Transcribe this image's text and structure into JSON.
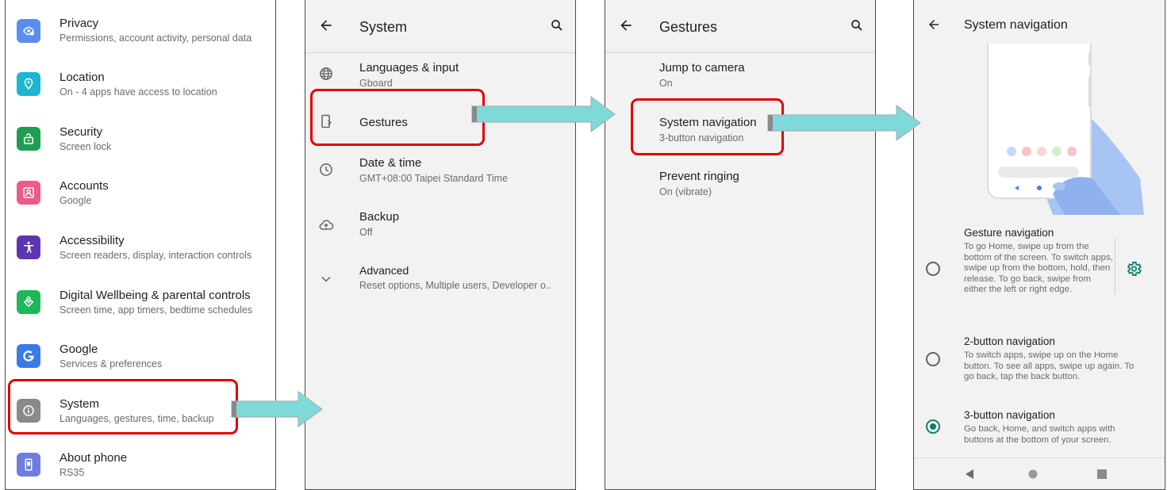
{
  "settings": {
    "items": [
      {
        "title": "Privacy",
        "subtitle": "Permissions, account activity, personal data",
        "icon": "privacy-icon",
        "color": "#5b8def"
      },
      {
        "title": "Location",
        "subtitle": "On - 4 apps have access to location",
        "icon": "location-icon",
        "color": "#1cb5d2"
      },
      {
        "title": "Security",
        "subtitle": "Screen lock",
        "icon": "lock-icon",
        "color": "#1e9e53"
      },
      {
        "title": "Accounts",
        "subtitle": "Google",
        "icon": "accounts-icon",
        "color": "#ec5b8d"
      },
      {
        "title": "Accessibility",
        "subtitle": "Screen readers, display, interaction controls",
        "icon": "accessibility-icon",
        "color": "#5e35b1"
      },
      {
        "title": "Digital Wellbeing & parental controls",
        "subtitle": "Screen time, app timers, bedtime schedules",
        "icon": "wellbeing-icon",
        "color": "#1cb85a"
      },
      {
        "title": "Google",
        "subtitle": "Services & preferences",
        "icon": "google-icon",
        "color": "#3a7be8"
      },
      {
        "title": "System",
        "subtitle": "Languages, gestures, time, backup",
        "icon": "info-icon",
        "color": "#8a8a8a"
      },
      {
        "title": "About phone",
        "subtitle": "RS35",
        "icon": "phone-icon",
        "color": "#6f7de0"
      }
    ]
  },
  "system": {
    "title": "System",
    "items": [
      {
        "title": "Languages & input",
        "subtitle": "Gboard",
        "icon": "globe-icon"
      },
      {
        "title": "Gestures",
        "subtitle": "",
        "icon": "gestures-icon"
      },
      {
        "title": "Date & time",
        "subtitle": "GMT+08:00 Taipei Standard Time",
        "icon": "clock-icon"
      },
      {
        "title": "Backup",
        "subtitle": "Off",
        "icon": "cloud-upload-icon"
      },
      {
        "title": "Advanced",
        "subtitle": "Reset options, Multiple users, Developer o..",
        "icon": "chevron-down-icon"
      }
    ]
  },
  "gestures": {
    "title": "Gestures",
    "items": [
      {
        "title": "Jump to camera",
        "subtitle": "On"
      },
      {
        "title": "System navigation",
        "subtitle": "3-button navigation"
      },
      {
        "title": "Prevent ringing",
        "subtitle": "On (vibrate)"
      }
    ]
  },
  "system_navigation": {
    "title": "System navigation",
    "options": [
      {
        "title": "Gesture navigation",
        "description": "To go Home, swipe up from the bottom of the screen. To switch apps, swipe up from the bottom, hold, then release. To go back, swipe from either the left or right edge.",
        "selected": false
      },
      {
        "title": "2-button navigation",
        "description": "To switch apps, swipe up on the Home button. To see all apps, swipe up again. To go back, tap the back button.",
        "selected": false
      },
      {
        "title": "3-button navigation",
        "description": "Go back, Home, and switch apps with buttons at the bottom of your screen.",
        "selected": true
      }
    ]
  },
  "colors": {
    "highlight": "#e00000",
    "arrow": "#7fd9d9",
    "accent": "#0f7f6c"
  }
}
